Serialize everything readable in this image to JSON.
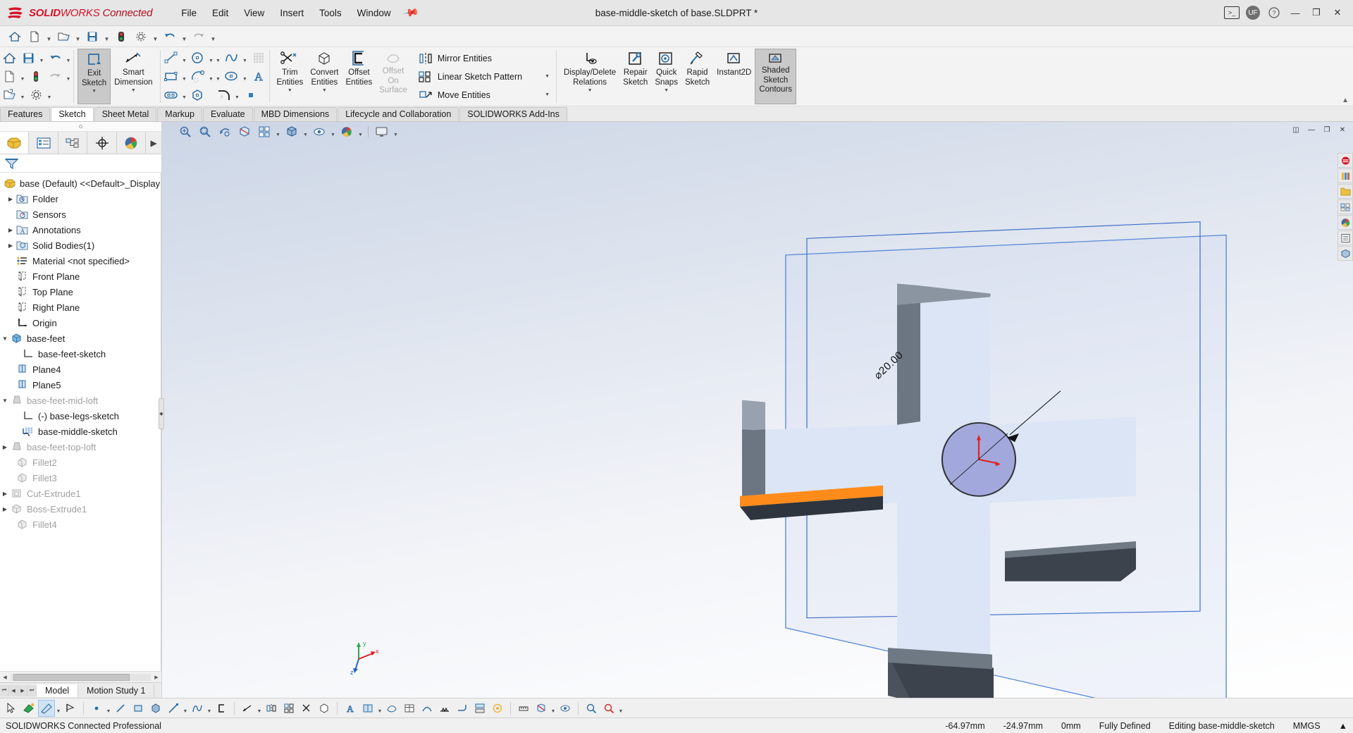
{
  "titlebar": {
    "brand_ds": "DS",
    "brand_solid": "SOLID",
    "brand_works": "WORKS",
    "brand_connected": "Connected",
    "document_title": "base-middle-sketch of base.SLDPRT *",
    "menus": [
      "File",
      "Edit",
      "View",
      "Insert",
      "Tools",
      "Window"
    ],
    "pin_icon": "pin-icon",
    "user_initials": "UF",
    "help_label": "?",
    "minimize_label": "—",
    "restore_label": "❐",
    "close_label": "✕"
  },
  "quick_access": {
    "items": [
      {
        "name": "home-icon",
        "arrow": false
      },
      {
        "name": "new-document-icon",
        "arrow": true
      },
      {
        "name": "open-document-icon",
        "arrow": true
      },
      {
        "name": "save-icon",
        "arrow": true
      },
      {
        "name": "print-icon",
        "arrow": false
      },
      {
        "name": "options-gear-icon",
        "arrow": true
      },
      {
        "name": "undo-icon",
        "arrow": true
      },
      {
        "name": "redo-icon",
        "arrow": true
      }
    ]
  },
  "ribbon": {
    "groups": [
      {
        "kind": "micro",
        "name": "file-micro-group",
        "rows": [
          [
            {
              "icon": "home-icon",
              "arrow": false
            },
            {
              "icon": "save-icon",
              "arrow": true
            },
            {
              "icon": "undo-icon",
              "arrow": true
            }
          ],
          [
            {
              "icon": "new-document-icon",
              "arrow": true
            },
            {
              "icon": "traffic-light-icon",
              "arrow": false
            },
            {
              "icon": "redo-icon",
              "arrow": true
            }
          ],
          [
            {
              "icon": "open-export-icon",
              "arrow": true
            },
            {
              "icon": "options-gear-icon",
              "arrow": true
            }
          ]
        ]
      },
      {
        "kind": "big",
        "name": "sketch-exit-group",
        "buttons": [
          {
            "label_lines": [
              "Exit",
              "Sketch"
            ],
            "icon": "exit-sketch-icon",
            "active": true,
            "dropdown": true,
            "disabled": false
          },
          {
            "label_lines": [
              "Smart",
              "Dimension"
            ],
            "icon": "smart-dimension-icon",
            "active": false,
            "dropdown": true,
            "disabled": false
          }
        ]
      },
      {
        "kind": "micro",
        "name": "sketch-entities-group",
        "rows": [
          [
            {
              "icon": "line-icon",
              "arrow": true
            },
            {
              "icon": "circle-icon",
              "arrow": true
            }
          ],
          [
            {
              "icon": "rectangle-icon",
              "arrow": true
            },
            {
              "icon": "arc-icon",
              "arrow": true
            }
          ],
          [
            {
              "icon": "slot-icon",
              "arrow": true
            },
            {
              "icon": "polygon-icon",
              "arrow": false
            }
          ]
        ]
      },
      {
        "kind": "micro",
        "name": "sketch-entities-group-2",
        "rows": [
          [
            {
              "icon": "spline-icon",
              "arrow": true
            },
            {
              "icon": "grid-icon",
              "arrow": false
            }
          ],
          [
            {
              "icon": "ellipse-icon",
              "arrow": true
            },
            {
              "icon": "text-icon",
              "arrow": false
            }
          ],
          [
            {
              "icon": "fillet-icon",
              "arrow": true
            },
            {
              "icon": "point-icon",
              "arrow": false
            }
          ]
        ]
      },
      {
        "kind": "big",
        "name": "modify-group",
        "buttons": [
          {
            "label_lines": [
              "Trim",
              "Entities"
            ],
            "icon": "trim-entities-icon",
            "active": false,
            "dropdown": true,
            "disabled": false
          },
          {
            "label_lines": [
              "Convert",
              "Entities"
            ],
            "icon": "convert-entities-icon",
            "active": false,
            "dropdown": true,
            "disabled": false
          },
          {
            "label_lines": [
              "Offset",
              "Entities"
            ],
            "icon": "offset-entities-icon",
            "active": false,
            "dropdown": false,
            "disabled": false
          },
          {
            "label_lines": [
              "Offset",
              "On",
              "Surface"
            ],
            "icon": "offset-on-surface-icon",
            "active": false,
            "dropdown": false,
            "disabled": true
          }
        ]
      },
      {
        "kind": "wide",
        "name": "pattern-group",
        "rows": [
          {
            "label": "Mirror Entities",
            "icon": "mirror-entities-icon",
            "arrow": false
          },
          {
            "label": "Linear Sketch Pattern",
            "icon": "linear-sketch-pattern-icon",
            "arrow": true
          },
          {
            "label": "Move Entities",
            "icon": "move-entities-icon",
            "arrow": true
          }
        ]
      },
      {
        "kind": "big",
        "name": "tools-group",
        "buttons": [
          {
            "label_lines": [
              "Display/Delete",
              "Relations"
            ],
            "icon": "display-delete-relations-icon",
            "active": false,
            "dropdown": true,
            "disabled": false
          },
          {
            "label_lines": [
              "Repair",
              "Sketch"
            ],
            "icon": "repair-sketch-icon",
            "active": false,
            "dropdown": false,
            "disabled": false
          },
          {
            "label_lines": [
              "Quick",
              "Snaps"
            ],
            "icon": "quick-snaps-icon",
            "active": false,
            "dropdown": true,
            "disabled": false
          },
          {
            "label_lines": [
              "Rapid",
              "Sketch"
            ],
            "icon": "rapid-sketch-icon",
            "active": false,
            "dropdown": false,
            "disabled": false
          },
          {
            "label_lines": [
              "Instant2D"
            ],
            "icon": "instant2d-icon",
            "active": false,
            "dropdown": false,
            "disabled": false
          },
          {
            "label_lines": [
              "Shaded",
              "Sketch",
              "Contours"
            ],
            "icon": "shaded-sketch-contours-icon",
            "active": true,
            "dropdown": false,
            "disabled": false
          }
        ]
      }
    ],
    "collapse_icon": "chevron-up-icon"
  },
  "tabs": {
    "items": [
      {
        "label": "Features",
        "selected": false
      },
      {
        "label": "Sketch",
        "selected": true
      },
      {
        "label": "Sheet Metal",
        "selected": false
      },
      {
        "label": "Markup",
        "selected": false
      },
      {
        "label": "Evaluate",
        "selected": false
      },
      {
        "label": "MBD Dimensions",
        "selected": false
      },
      {
        "label": "Lifecycle and Collaboration",
        "selected": false
      },
      {
        "label": "SOLIDWORKS Add-Ins",
        "selected": false
      }
    ]
  },
  "feature_manager": {
    "tabs": [
      {
        "name": "feature-tree-tab",
        "icon": "feature-tree-icon",
        "selected": true
      },
      {
        "name": "property-manager-tab",
        "icon": "property-manager-icon",
        "selected": false
      },
      {
        "name": "configuration-manager-tab",
        "icon": "configuration-manager-icon",
        "selected": false
      },
      {
        "name": "dimxpert-manager-tab",
        "icon": "dimxpert-icon",
        "selected": false
      },
      {
        "name": "display-manager-tab",
        "icon": "display-manager-icon",
        "selected": false
      }
    ],
    "more_icon": "chevron-right-icon",
    "filter_icon": "filter-icon",
    "tree": [
      {
        "label": "base (Default) <<Default>_Display Sta",
        "icon": "part-icon",
        "indent": 0,
        "expand": "none",
        "dim": false
      },
      {
        "label": "Folder",
        "icon": "history-folder-icon",
        "indent": 1,
        "expand": "collapsed",
        "dim": false
      },
      {
        "label": "Sensors",
        "icon": "sensors-icon",
        "indent": 1,
        "expand": "none",
        "dim": false
      },
      {
        "label": "Annotations",
        "icon": "annotations-icon",
        "indent": 1,
        "expand": "collapsed",
        "dim": false
      },
      {
        "label": "Solid Bodies(1)",
        "icon": "solid-bodies-icon",
        "indent": 1,
        "expand": "collapsed",
        "dim": false
      },
      {
        "label": "Material <not specified>",
        "icon": "material-icon",
        "indent": 1,
        "expand": "none",
        "dim": false
      },
      {
        "label": "Front Plane",
        "icon": "plane-icon",
        "indent": 1,
        "expand": "none",
        "dim": false
      },
      {
        "label": "Top Plane",
        "icon": "plane-icon",
        "indent": 1,
        "expand": "none",
        "dim": false
      },
      {
        "label": "Right Plane",
        "icon": "plane-icon",
        "indent": 1,
        "expand": "none",
        "dim": false
      },
      {
        "label": "Origin",
        "icon": "origin-icon",
        "indent": 1,
        "expand": "none",
        "dim": false
      },
      {
        "label": "base-feet",
        "icon": "extrude-icon",
        "indent": 1,
        "expand": "expanded",
        "dim": false
      },
      {
        "label": "base-feet-sketch",
        "icon": "sketch-icon",
        "indent": 2,
        "expand": "none",
        "dim": false
      },
      {
        "label": "Plane4",
        "icon": "plane-blue-icon",
        "indent": 1,
        "expand": "none",
        "dim": false
      },
      {
        "label": "Plane5",
        "icon": "plane-blue-icon",
        "indent": 1,
        "expand": "none",
        "dim": false
      },
      {
        "label": "base-feet-mid-loft",
        "icon": "loft-icon",
        "indent": 1,
        "expand": "expanded",
        "dim": true
      },
      {
        "label": "(-) base-legs-sketch",
        "icon": "sketch-icon",
        "indent": 2,
        "expand": "none",
        "dim": false
      },
      {
        "label": "base-middle-sketch",
        "icon": "editing-sketch-icon",
        "indent": 2,
        "expand": "none",
        "dim": false
      },
      {
        "label": "base-feet-top-loft",
        "icon": "loft-icon",
        "indent": 1,
        "expand": "collapsed",
        "dim": true
      },
      {
        "label": "Fillet2",
        "icon": "fillet-icon-tree",
        "indent": 1,
        "expand": "none",
        "dim": true
      },
      {
        "label": "Fillet3",
        "icon": "fillet-icon-tree",
        "indent": 1,
        "expand": "none",
        "dim": true
      },
      {
        "label": "Cut-Extrude1",
        "icon": "cut-extrude-icon",
        "indent": 1,
        "expand": "collapsed",
        "dim": true
      },
      {
        "label": "Boss-Extrude1",
        "icon": "boss-extrude-icon",
        "indent": 1,
        "expand": "collapsed",
        "dim": true
      },
      {
        "label": "Fillet4",
        "icon": "fillet-icon-tree",
        "indent": 1,
        "expand": "none",
        "dim": true
      }
    ],
    "bottom_tabs": [
      {
        "label": "Model",
        "selected": true
      },
      {
        "label": "Motion Study 1",
        "selected": false
      }
    ]
  },
  "viewport": {
    "toolbar": [
      {
        "name": "zoom-to-fit-icon",
        "arrow": false
      },
      {
        "name": "zoom-area-icon",
        "arrow": false
      },
      {
        "name": "previous-view-icon",
        "arrow": false
      },
      {
        "name": "section-view-icon",
        "arrow": false
      },
      {
        "name": "view-orientation-icon",
        "arrow": true
      },
      {
        "name": "display-style-icon",
        "arrow": true
      },
      {
        "name": "hide-show-items-icon",
        "arrow": true
      },
      {
        "name": "appearances-icon",
        "arrow": true
      },
      {
        "name": "apply-scene-icon",
        "arrow": true
      },
      {
        "name": "view-settings-icon",
        "arrow": true
      }
    ],
    "window_buttons": [
      {
        "name": "restore-pane-icon",
        "label": "◫"
      },
      {
        "name": "minimize-pane-icon",
        "label": "—"
      },
      {
        "name": "maximize-pane-icon",
        "label": "❐"
      },
      {
        "name": "close-pane-icon",
        "label": "✕"
      }
    ],
    "right_dock": [
      "sw-resources-icon",
      "design-library-icon",
      "file-explorer-icon",
      "view-palette-icon",
      "appearances-scenes-icon",
      "custom-properties-icon",
      "display-manager-dock-icon"
    ],
    "dimension_label": "⌀20.00",
    "triad_axes": {
      "x": "x",
      "y": "y",
      "z": "z"
    },
    "colors": {
      "sketch_plane_fill": "#cfdbf3",
      "sketch_plane_border": "#3c6fd1",
      "circle_fill": "#9a9ed8",
      "highlight_orange": "#ff8c1a",
      "model_gray": "#7d8590",
      "model_dark": "#3d434d"
    }
  },
  "bottom_toolbar": {
    "items": [
      {
        "name": "select-cursor-icon",
        "arrow": false,
        "selected": false
      },
      {
        "name": "sketch-color-icon",
        "arrow": false,
        "selected": false
      },
      {
        "name": "sketch-pencil-icon",
        "arrow": true,
        "selected": true
      },
      {
        "name": "no-relation-icon",
        "arrow": false,
        "selected": false
      },
      {
        "name": "point-tool-icon",
        "arrow": true,
        "selected": false
      },
      {
        "name": "line-tool-icon",
        "arrow": false,
        "selected": false
      },
      {
        "name": "corner-rect-icon",
        "arrow": false,
        "selected": false
      },
      {
        "name": "box-tool-icon",
        "arrow": false,
        "selected": false
      },
      {
        "name": "line-draw-icon",
        "arrow": true,
        "selected": false
      },
      {
        "name": "spline-tool-icon",
        "arrow": true,
        "selected": false
      },
      {
        "name": "c-shape-icon",
        "arrow": false,
        "selected": false
      },
      {
        "name": "dim-tool-icon",
        "arrow": true,
        "selected": false
      },
      {
        "name": "mirror-tool-icon",
        "arrow": false,
        "selected": false
      },
      {
        "name": "pattern-tool-icon",
        "arrow": false,
        "selected": false
      },
      {
        "name": "trim-tool-icon",
        "arrow": false,
        "selected": false
      },
      {
        "name": "convert-tool-icon",
        "arrow": false,
        "selected": false
      },
      {
        "name": "text-tool-icon",
        "arrow": false,
        "selected": false
      },
      {
        "name": "plane-tool-icon",
        "arrow": true,
        "selected": false
      },
      {
        "name": "surface-tool-icon",
        "arrow": false,
        "selected": false
      },
      {
        "name": "table-tool-icon",
        "arrow": true,
        "selected": false
      },
      {
        "name": "curve-tool-icon",
        "arrow": true,
        "selected": false
      },
      {
        "name": "weld-tool-icon",
        "arrow": false,
        "selected": false
      },
      {
        "name": "sheetmetal-tool-icon",
        "arrow": false,
        "selected": false
      },
      {
        "name": "mold-tool-icon",
        "arrow": false,
        "selected": false
      },
      {
        "name": "render-tool-icon",
        "arrow": false,
        "selected": false
      },
      {
        "name": "measure-tool-icon",
        "arrow": false,
        "selected": false
      },
      {
        "name": "section-tool-icon",
        "arrow": true,
        "selected": false
      },
      {
        "name": "display-tool-icon",
        "arrow": false,
        "selected": false
      },
      {
        "name": "zoom-tool-icon",
        "arrow": false,
        "selected": false
      },
      {
        "name": "magnify-tool-icon",
        "arrow": true,
        "selected": false
      }
    ]
  },
  "statusbar": {
    "left_text": "SOLIDWORKS Connected Professional",
    "coord_x": "-64.97mm",
    "coord_y": "-24.97mm",
    "coord_z": "0mm",
    "state": "Fully Defined",
    "editing": "Editing base-middle-sketch",
    "units": "MMGS",
    "expander_icon": "chevron-up-icon"
  }
}
